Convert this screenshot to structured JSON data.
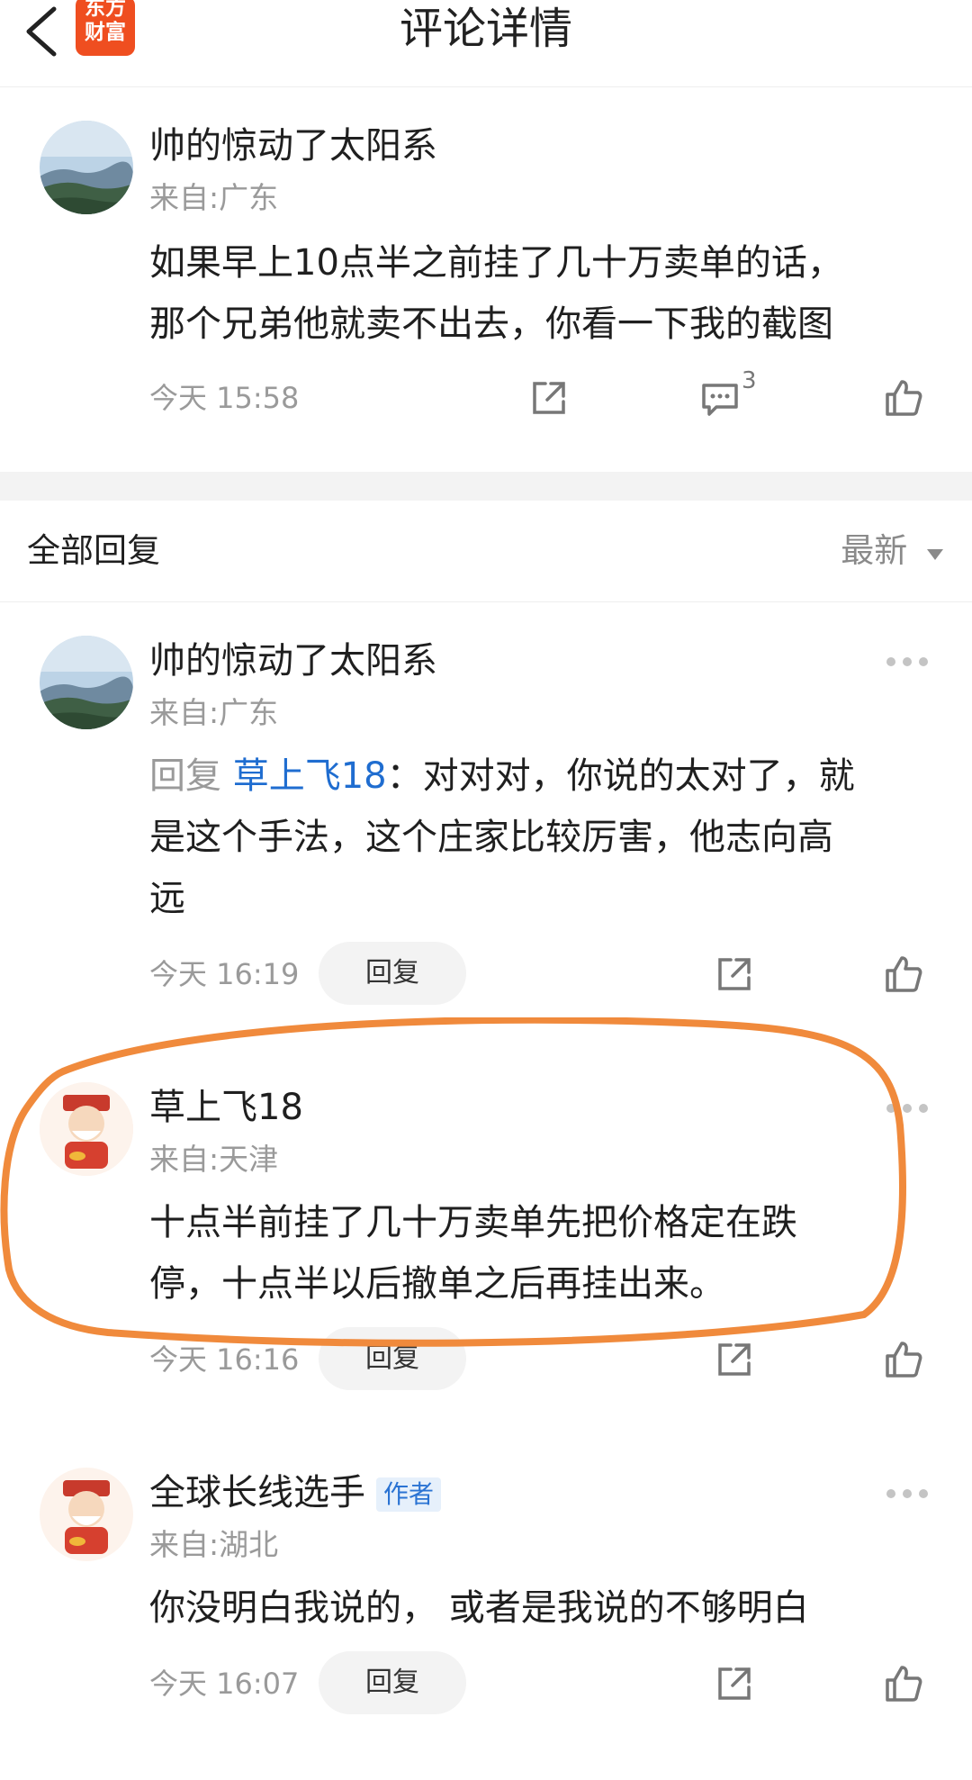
{
  "header": {
    "title": "评论详情",
    "logo_line1": "东方",
    "logo_line2": "财富"
  },
  "main_comment": {
    "user": "帅的惊动了太阳系",
    "location": "来自:广东",
    "text_line1": "如果早上10点半之前挂了几十万卖单的话，",
    "text_line2": "那个兄弟他就卖不出去，你看一下我的截图",
    "time": "今天 15:58",
    "comment_count": "3"
  },
  "replies_header": {
    "label": "全部回复",
    "sort": "最新"
  },
  "replies": [
    {
      "user": "帅的惊动了太阳系",
      "location": "来自:广东",
      "reply_prefix": "回复",
      "mention": "草上飞18",
      "text_line1": "：对对对，你说的太对了，就",
      "text_line2": "是这个手法，这个庄家比较厉害，他志向高",
      "text_line3": "远",
      "time": "今天 16:19",
      "reply_btn": "回复"
    },
    {
      "user": "草上飞18",
      "location": "来自:天津",
      "text_line1": "十点半前挂了几十万卖单先把价格定在跌",
      "text_line2": "停，十点半以后撤单之后再挂出来。",
      "time": "今天 16:16",
      "reply_btn": "回复"
    },
    {
      "user": "全球长线选手",
      "badge": "作者",
      "location": "来自:湖北",
      "text_line1": "你没明白我说的， 或者是我说的不够明白",
      "time": "今天 16:07",
      "reply_btn": "回复"
    }
  ],
  "colors": {
    "accent": "#ef4e20",
    "mention": "#1f6dd0",
    "annotation": "#f08a3c"
  },
  "icons": [
    "back-arrow-icon",
    "share-icon",
    "comment-icon",
    "like-icon",
    "more-icon",
    "sort-triangle-icon"
  ]
}
